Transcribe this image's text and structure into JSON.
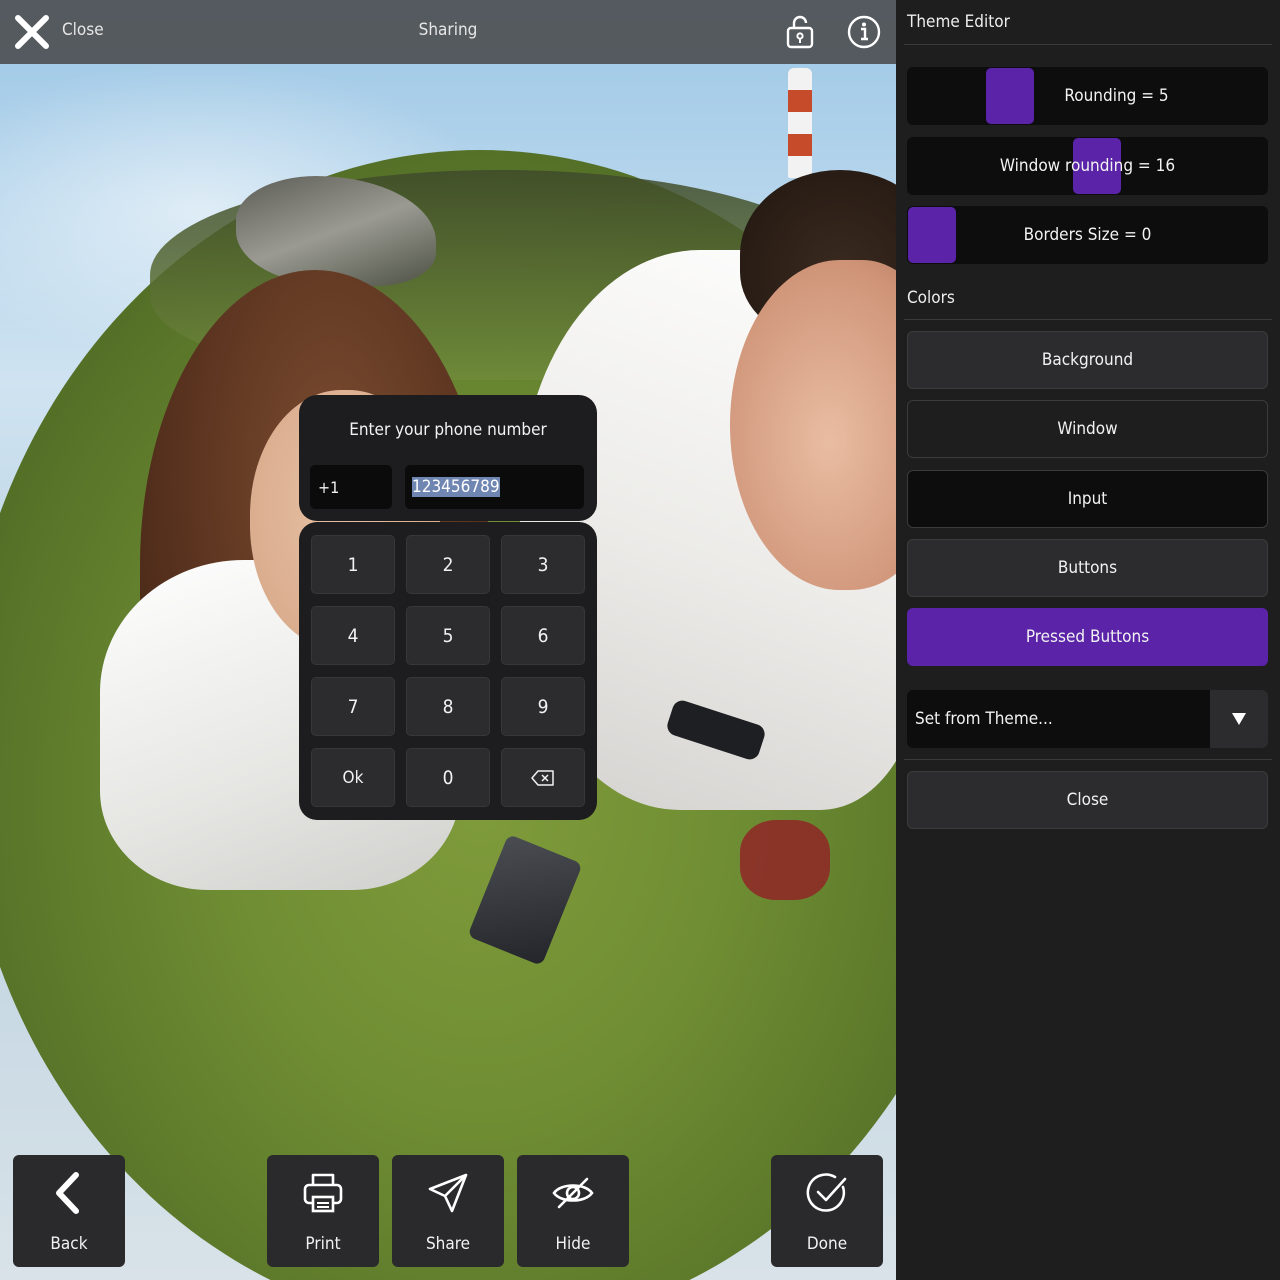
{
  "topbar": {
    "close_label": "Close",
    "title": "Sharing",
    "icons": [
      "close-x-icon",
      "unlock-icon",
      "info-icon"
    ]
  },
  "phone_dialog": {
    "prompt": "Enter your phone number",
    "country_code": "+1",
    "phone_number": "123456789",
    "keys": [
      "1",
      "2",
      "3",
      "4",
      "5",
      "6",
      "7",
      "8",
      "9",
      "Ok",
      "0"
    ],
    "backspace_icon": "backspace-icon"
  },
  "bottom_bar": {
    "back": "Back",
    "print": "Print",
    "share": "Share",
    "hide": "Hide",
    "done": "Done"
  },
  "theme_editor": {
    "title": "Theme Editor",
    "rounding_label": "Rounding = 5",
    "rounding_value": 5,
    "window_rounding_label": "Window rounding = 16",
    "window_rounding_value": 16,
    "borders_size_label": "Borders Size = 0",
    "borders_size_value": 0,
    "colors_heading": "Colors",
    "color_buttons": {
      "background": "Background",
      "window": "Window",
      "input": "Input",
      "buttons": "Buttons",
      "pressed_buttons": "Pressed Buttons"
    },
    "combo_value": "Set from Theme...",
    "close_label": "Close"
  },
  "colors": {
    "accent": "#5a23a8",
    "panel_bg": "#1e1e1e",
    "button_bg": "#2c2c2e",
    "input_bg": "#0d0d0d"
  }
}
